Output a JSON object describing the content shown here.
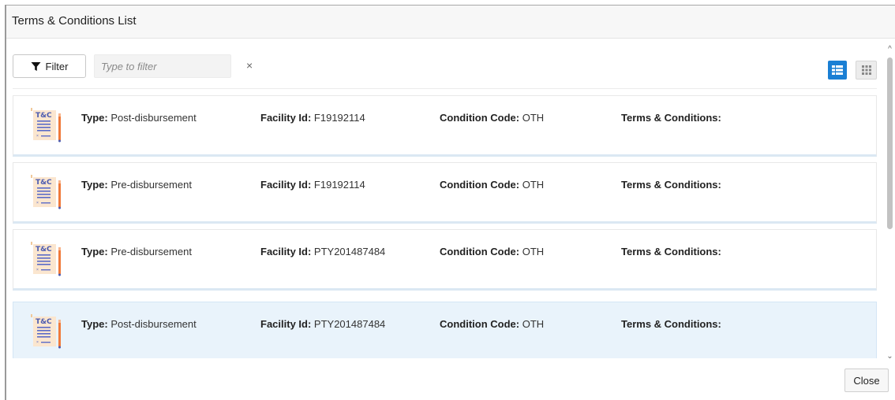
{
  "dialog": {
    "title": "Terms & Conditions List"
  },
  "toolbar": {
    "filter_label": "Filter",
    "filter_placeholder": "Type to filter",
    "filter_value": "",
    "clear_symbol": "×",
    "view_modes": [
      "list-view",
      "grid-view"
    ],
    "active_view": "list-view"
  },
  "labels": {
    "type": "Type:",
    "facility": "Facility Id:",
    "condition": "Condition Code:",
    "terms": "Terms & Conditions:"
  },
  "icon": {
    "name": "tc-document-icon",
    "badge_text": "T&C"
  },
  "items": [
    {
      "type": "Post-disbursement",
      "facility_id": "F19192114",
      "condition_code": "OTH",
      "terms": "",
      "selected": false
    },
    {
      "type": "Pre-disbursement",
      "facility_id": "F19192114",
      "condition_code": "OTH",
      "terms": "",
      "selected": false
    },
    {
      "type": "Pre-disbursement",
      "facility_id": "PTY201487484",
      "condition_code": "OTH",
      "terms": "",
      "selected": false
    },
    {
      "type": "Post-disbursement",
      "facility_id": "PTY201487484",
      "condition_code": "OTH",
      "terms": "",
      "selected": true
    }
  ],
  "footer": {
    "close_label": "Close"
  },
  "colors": {
    "accent": "#1a7fd4",
    "selected_row": "#e9f3fb"
  }
}
